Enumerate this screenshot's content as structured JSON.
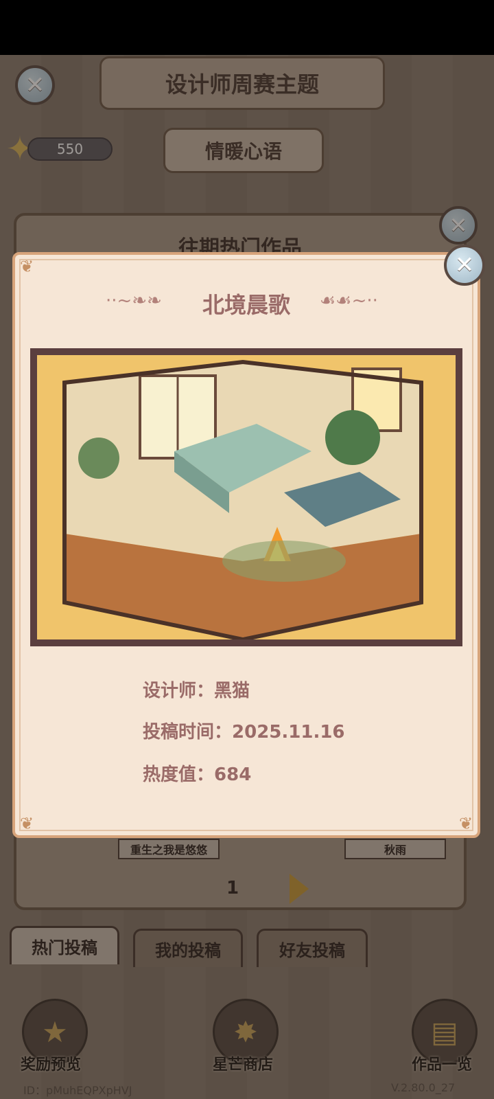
{
  "header": {
    "title": "设计师周赛主题",
    "theme": "情暖心语",
    "stars": "550"
  },
  "bg_panel": {
    "title": "往期热门作品",
    "entries": [
      {
        "designer": "重生之我是悠悠"
      },
      {
        "designer": "秋雨"
      }
    ],
    "page": "1"
  },
  "tabs": [
    {
      "label": "热门投稿",
      "active": true
    },
    {
      "label": "我的投稿",
      "active": false
    },
    {
      "label": "好友投稿",
      "active": false
    }
  ],
  "bottom_nav": [
    {
      "label": "奖励预览",
      "icon": "trophy-icon"
    },
    {
      "label": "星芒商店",
      "icon": "star-shop-icon"
    },
    {
      "label": "作品一览",
      "icon": "book-icon"
    }
  ],
  "footer": {
    "id": "ID：pMuhEQPXpHVJ",
    "version": "V.2.80.0_27"
  },
  "modal": {
    "title": "北境晨歌",
    "designer_label": "设计师：",
    "designer": "黑猫",
    "time_label": "投稿时间：",
    "time": "2025.11.16",
    "heat_label": "热度值：",
    "heat": "684"
  },
  "colors": {
    "modal_bg": "#f6e6d6",
    "modal_border": "#d7a47b",
    "text_accent": "#9a6b68",
    "star_gold": "#d9b45a"
  }
}
